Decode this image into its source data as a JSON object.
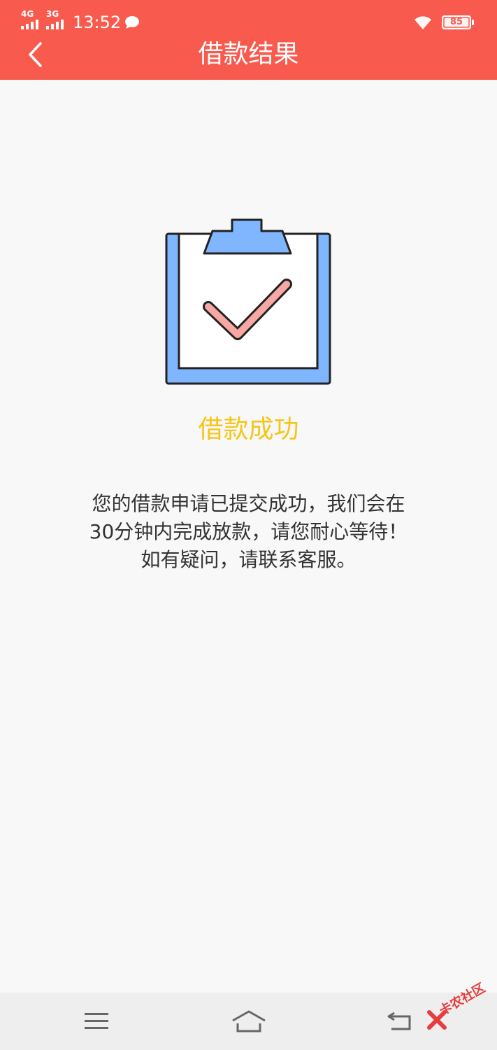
{
  "status_bar": {
    "network1": "4G",
    "network2": "3G",
    "time": "13:52",
    "battery": "85",
    "icons": [
      "signal-icon",
      "chat-icon",
      "wifi-icon",
      "battery-icon"
    ]
  },
  "header": {
    "title": "借款结果",
    "back_icon": "chevron-left-icon"
  },
  "result": {
    "illustration_icon": "clipboard-check-icon",
    "title": "借款成功",
    "message_lines": [
      "您的借款申请已提交成功，我们会在",
      "30分钟内完成放款，请您耐心等待！",
      "如有疑问，请联系客服。"
    ]
  },
  "nav_bar": {
    "icons": [
      "menu-icon",
      "home-icon",
      "back-icon"
    ]
  },
  "watermark": {
    "text": "卡农社区"
  },
  "colors": {
    "header_bg": "#f85a4e",
    "title_text": "#ffffff",
    "success_title": "#f5c518",
    "message_text": "#333333",
    "clipboard_blue": "#7fb6ff",
    "check_pink": "#f8a8a4"
  }
}
